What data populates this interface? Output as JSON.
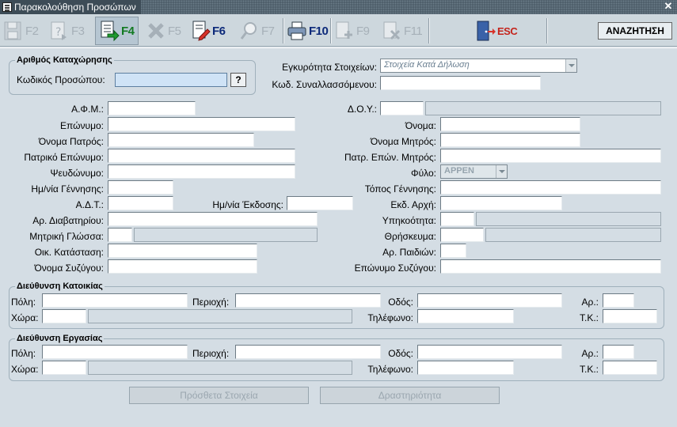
{
  "window": {
    "title": "Παρακολούθηση Προσώπων",
    "close": "✕"
  },
  "toolbar": {
    "buttons": [
      {
        "key": "F2",
        "icon": "save-icon",
        "enabled": false
      },
      {
        "key": "F3",
        "icon": "query-icon",
        "enabled": false
      },
      {
        "key": "F4",
        "icon": "document-enter-icon",
        "enabled": true
      },
      {
        "key": "F5",
        "icon": "delete-icon",
        "enabled": false
      },
      {
        "key": "F6",
        "icon": "edit-document-icon",
        "enabled": true
      },
      {
        "key": "F7",
        "icon": "search-icon",
        "enabled": false
      },
      {
        "key": "F10",
        "icon": "print-icon",
        "enabled": true
      },
      {
        "key": "F9",
        "icon": "add-icon",
        "enabled": false
      },
      {
        "key": "F11",
        "icon": "remove-icon",
        "enabled": false
      },
      {
        "key": "ESC",
        "icon": "exit-door-icon",
        "enabled": true
      }
    ],
    "search_label": "ΑΝΑΖΗΤΗΣΗ"
  },
  "registration": {
    "group_title": "Αριθμός Καταχώρησης",
    "code_label": "Κωδικός Προσώπου:",
    "code_value": "",
    "lookup_label": "?"
  },
  "validity": {
    "label": "Εγκυρότητα Στοιχείων:",
    "value": "Στοιχεία Κατά Δήλωση",
    "trader_code_label": "Κωδ. Συναλλασσόμενου:"
  },
  "person": {
    "afm": "Α.Φ.Μ.:",
    "doy": "Δ.Ο.Υ.:",
    "surname": "Επώνυμο:",
    "name": "Όνομα:",
    "father_name": "Όνομα Πατρός:",
    "mother_name": "Όνομα Μητρός:",
    "father_surname": "Πατρικό Επώνυμο:",
    "mother_surname": "Πατρ. Επών. Μητρός:",
    "nickname": "Ψευδώνυμο:",
    "gender": "Φύλο:",
    "gender_value": "APPEN",
    "birth_date": "Ημ/νία Γέννησης:",
    "birth_place": "Τόπος Γέννησης:",
    "id_number": "Α.Δ.Τ.:",
    "issue_date": "Ημ/νία Έκδοσης:",
    "issuing_authority": "Εκδ. Αρχή:",
    "passport": "Αρ. Διαβατηρίου:",
    "citizenship": "Υπηκοότητα:",
    "mother_tongue": "Μητρική Γλώσσα:",
    "religion": "Θρήσκευμα:",
    "marital_status": "Οικ. Κατάσταση:",
    "children": "Αρ. Παιδιών:",
    "spouse_name": "Όνομα Συζύγου:",
    "spouse_surname": "Επώνυμο Συζύγου:"
  },
  "home_address": {
    "title": "Διεύθυνση Κατοικίας",
    "city": "Πόλη:",
    "area": "Περιοχή:",
    "street": "Οδός:",
    "number": "Αρ.:",
    "country": "Χώρα:",
    "phone": "Τηλέφωνο:",
    "zip": "Τ.Κ.:"
  },
  "work_address": {
    "title": "Διεύθυνση Εργασίας",
    "city": "Πόλη:",
    "area": "Περιοχή:",
    "street": "Οδός:",
    "number": "Αρ.:",
    "country": "Χώρα:",
    "phone": "Τηλέφωνο:",
    "zip": "Τ.Κ.:"
  },
  "footer": {
    "extra_info": "Πρόσθετα Στοιχεία",
    "activity": "Δραστηριότητα"
  }
}
